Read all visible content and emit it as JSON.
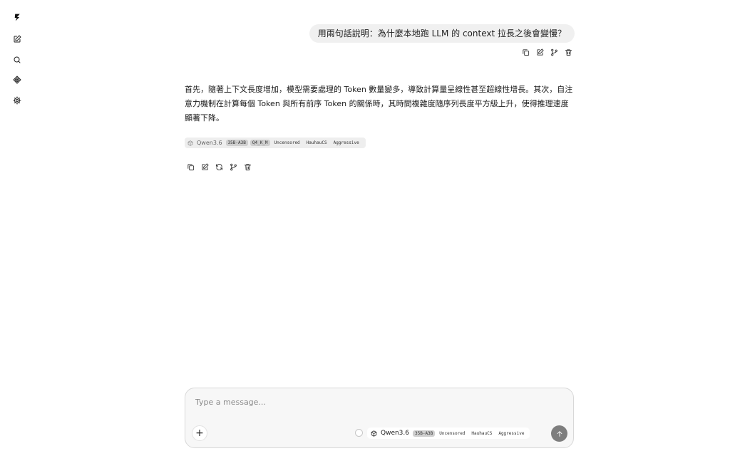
{
  "sidebar": {
    "items": [
      {
        "icon": "bolt-logo-icon"
      },
      {
        "icon": "new-chat-icon"
      },
      {
        "icon": "search-icon"
      },
      {
        "icon": "models-icon"
      },
      {
        "icon": "gear-icon"
      }
    ]
  },
  "conversation": {
    "user_message": "用兩句話說明：為什麼本地跑 LLM 的 context 拉長之後會變慢？",
    "assistant_answer": "首先，隨著上下文長度增加，模型需要處理的 Token 數量變多，導致計算量呈線性甚至超線性增長。其次，自注意力機制在計算每個 Token 與所有前序 Token 的關係時，其時間複雜度隨序列長度平方級上升，使得推理速度顯著下降。",
    "answer_model": {
      "name": "Qwen3.6",
      "tags": [
        "35B-A3B",
        "Q4_K_M",
        "Uncensored",
        "HauhauCS",
        "Aggressive"
      ]
    }
  },
  "composer": {
    "placeholder": "Type a message...",
    "value": "",
    "plus_label": "+",
    "model": {
      "name": "Qwen3.6",
      "tags": [
        "35B-A3B",
        "Uncensored",
        "HauhauCS",
        "Aggressive"
      ]
    }
  },
  "colors": {
    "bubble_bg": "#f0f0f0",
    "chip_bg": "#eeeeee",
    "send_button": "#7e7e7e"
  }
}
